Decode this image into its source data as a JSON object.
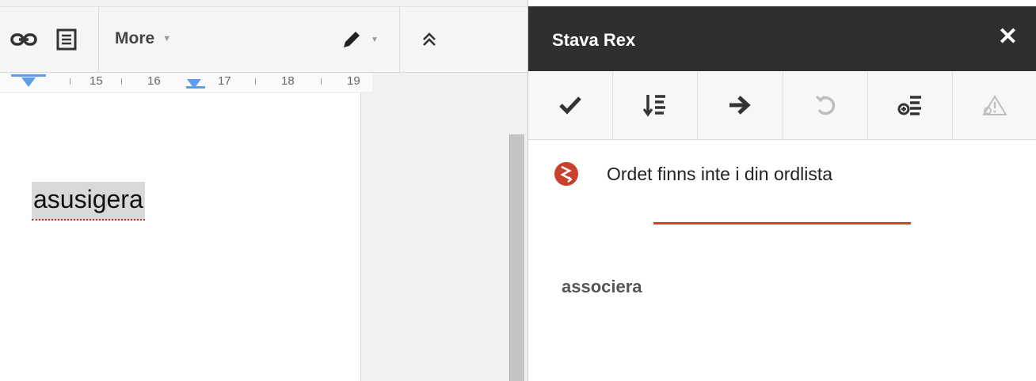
{
  "toolbar": {
    "more_label": "More",
    "icons": [
      "link-icon",
      "comment-icon",
      "pen-icon",
      "collapse-icon"
    ]
  },
  "ruler": {
    "labels": [
      "15",
      "16",
      "17",
      "18",
      "19"
    ]
  },
  "document": {
    "word": "asusigera"
  },
  "sidebar": {
    "title": "Stava Rex",
    "close_label": "✕",
    "tools": [
      "check-icon",
      "sort-icon",
      "arrow-right-icon",
      "undo-icon",
      "add-word-icon",
      "warning-icon"
    ],
    "issue_icon": "spell-error-icon",
    "issue_text": "Ordet finns inte i din ordlista",
    "suggestion": "associera"
  },
  "colors": {
    "sidebar_header_bg": "#2f2f2f",
    "accent_red": "#d2412d",
    "ruler_marker": "#5c9ded"
  }
}
